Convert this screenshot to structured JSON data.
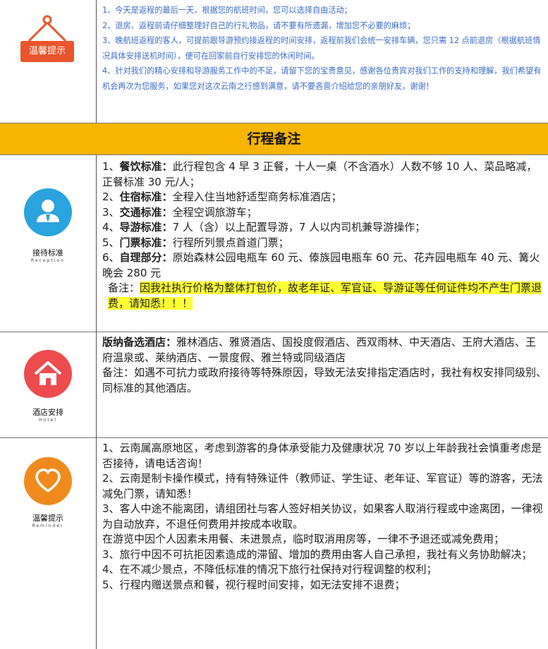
{
  "top": {
    "badge": "温馨提示",
    "lines": [
      "1、今天是返程的最后一天，根据您的航班时间，您可以选择自由活动；",
      "2、退房、返程前请仔细整理好自己的行礼物品，请不要有所遗漏，增加您不必要的麻烦；",
      "3、晚航班返程的客人，可提前跟导游预约接返程的时间安排，返程前我们会统一安排车辆，您只需 12 点前退房（根据航班情况具体安排送机时间），便可在回家前自行安排您的休闲时间。",
      "4、针对我们的精心安排和导游服务工作中的不足，请留下您的宝贵意见，感谢各位贵宾对我们工作的支持和理解，我们希望有机会再次为您服务，如果您对这次云南之行感到满意，请不要吝啬介绍给您的亲朋好友，谢谢！"
    ]
  },
  "title": "行程备注",
  "reception": {
    "caption": "接待标准",
    "caption_en": "Reception",
    "items": [
      {
        "num": "1、",
        "label": "餐饮标准：",
        "text": "此行程包含 4 早 3 正餐，十人一桌（不含酒水）人数不够 10 人、菜品略减，正餐标准 30 元/人；"
      },
      {
        "num": "2、",
        "label": "住宿标准：",
        "text": "全程入住当地舒适型商务标准酒店；"
      },
      {
        "num": "3、",
        "label": "交通标准：",
        "text": "全程空调旅游车；"
      },
      {
        "num": "4、",
        "label": "导游标准：",
        "text": "7 人（含）以上配置导游，7 人以内司机兼导游操作；"
      },
      {
        "num": "5、",
        "label": "门票标准：",
        "text": "行程所列景点首道门票；"
      },
      {
        "num": "6、",
        "label": "自理部分：",
        "text": "原始森林公园电瓶车 60 元、傣族园电瓶车 60 元、花卉园电瓶车 40 元、篝火晚会 280 元"
      }
    ],
    "note_label": "备注：",
    "note_text": "因我社执行价格为整体打包价，故老年证、军官证、导游证等任何证件均不产生门票退费，请知悉！！！"
  },
  "hotel": {
    "caption": "酒店安排",
    "caption_en": "Hotel",
    "label": "版纳备选酒店：",
    "text": "雅林酒店、雅贤酒店、国投度假酒店、西双雨林、中天酒店、王府大酒店、王府温泉或、莱纳酒店、一景度假、雅兰特或同级酒店",
    "note": "备注：如遇不可抗力或政府接待等特殊原因，导致无法安排指定酒店时，我社有权安排同级别、同标准的其他酒店。"
  },
  "reminder": {
    "caption": "温馨提示",
    "caption_en": "Reminder",
    "lines": [
      "1、云南属高原地区，考虑到游客的身体承受能力及健康状况 70 岁以上年龄我社会慎重考虑是否接待，请电话咨询！",
      "2、云南是制卡操作模式，持有特殊证件（教师证、学生证、老年证、军官证）等的游客，无法减免门票，请知悉！",
      "3、客人中途不能离团，请组团社与客人签好相关协议，如果客人取消行程或中途离团，一律视为自动放弃，不退任何费用并按成本收取。",
      "在游览中因个人因素未用餐、未进景点，临时取消用房等，一律不予退还或减免费用；",
      "3、旅行中因不可抗拒因素造成的滞留、增加的费用由客人自己承担，我社有义务协助解决；",
      "4、在不减少景点，不降低标准的情况下旅行社保持对行程调整的权利；",
      "5、行程内赠送景点和餐，视行程时间安排，如无法安排不退费；"
    ]
  },
  "colors": {
    "title_bar": "#f7b500",
    "badge": "#e9552d",
    "reception_circle": "#2aa3de",
    "hotel_circle": "#ee4b4e",
    "reminder_circle": "#f08a1c",
    "highlight": "#ffff33",
    "top_text": "#3a6dc4"
  },
  "icons": {
    "top": "hanging-sign-icon",
    "reception": "person-icon",
    "hotel": "house-icon",
    "reminder": "heart-icon"
  }
}
